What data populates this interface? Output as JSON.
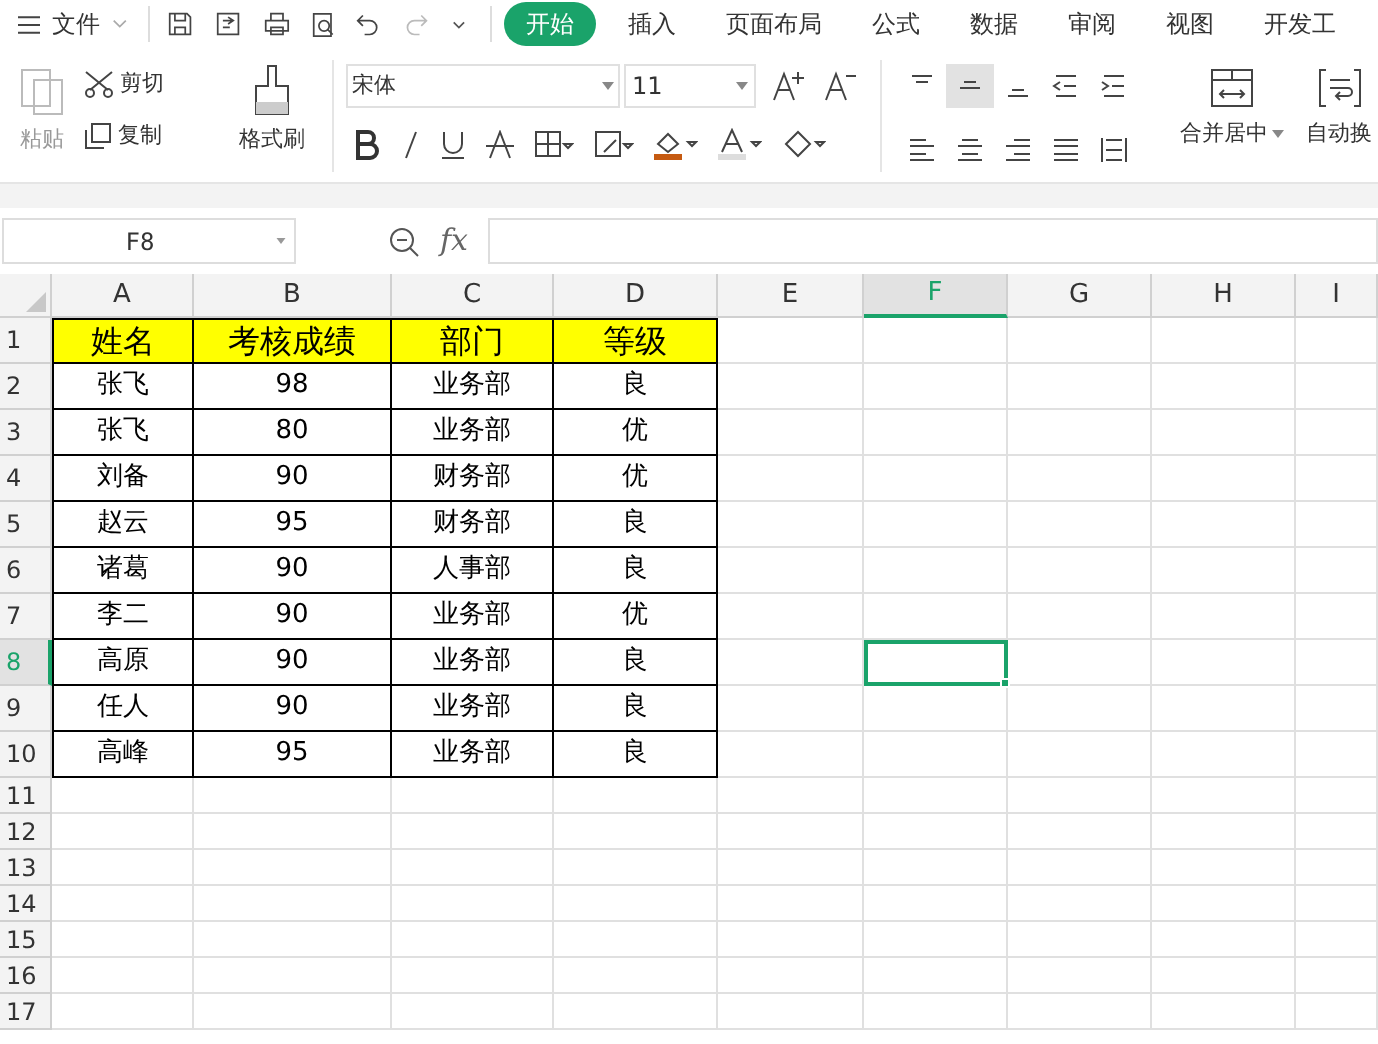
{
  "menu": {
    "file": "文件"
  },
  "tabs": [
    {
      "label": "开始",
      "selected": true
    },
    {
      "label": "插入",
      "selected": false
    },
    {
      "label": "页面布局",
      "selected": false
    },
    {
      "label": "公式",
      "selected": false
    },
    {
      "label": "数据",
      "selected": false
    },
    {
      "label": "审阅",
      "selected": false
    },
    {
      "label": "视图",
      "selected": false
    },
    {
      "label": "开发工",
      "selected": false
    }
  ],
  "ribbon": {
    "paste": "粘贴",
    "cut": "剪切",
    "copy": "复制",
    "format_painter": "格式刷",
    "font": "宋体",
    "font_size": "11",
    "merge_center": "合并居中",
    "wrap_text": "自动换"
  },
  "name_box": "F8",
  "formula_label": "fx",
  "columns": [
    {
      "label": "A",
      "selected": false
    },
    {
      "label": "B",
      "selected": false
    },
    {
      "label": "C",
      "selected": false
    },
    {
      "label": "D",
      "selected": false
    },
    {
      "label": "E",
      "selected": false
    },
    {
      "label": "F",
      "selected": true
    },
    {
      "label": "G",
      "selected": false
    },
    {
      "label": "H",
      "selected": false
    },
    {
      "label": "I",
      "selected": false
    }
  ],
  "rows": [
    {
      "label": "1",
      "kind": "header",
      "selected": false,
      "cells": [
        "姓名",
        "考核成绩",
        "部门",
        "等级"
      ]
    },
    {
      "label": "2",
      "kind": "data",
      "selected": false,
      "cells": [
        "张飞",
        "98",
        "业务部",
        "良"
      ]
    },
    {
      "label": "3",
      "kind": "data",
      "selected": false,
      "cells": [
        "张飞",
        "80",
        "业务部",
        "优"
      ]
    },
    {
      "label": "4",
      "kind": "data",
      "selected": false,
      "cells": [
        "刘备",
        "90",
        "财务部",
        "优"
      ]
    },
    {
      "label": "5",
      "kind": "data",
      "selected": false,
      "cells": [
        "赵云",
        "95",
        "财务部",
        "良"
      ]
    },
    {
      "label": "6",
      "kind": "data",
      "selected": false,
      "cells": [
        "诸葛",
        "90",
        "人事部",
        "良"
      ]
    },
    {
      "label": "7",
      "kind": "data",
      "selected": false,
      "cells": [
        "李二",
        "90",
        "业务部",
        "优"
      ]
    },
    {
      "label": "8",
      "kind": "data",
      "selected": true,
      "cells": [
        "高原",
        "90",
        "业务部",
        "良"
      ]
    },
    {
      "label": "9",
      "kind": "data",
      "selected": false,
      "cells": [
        "任人",
        "90",
        "业务部",
        "良"
      ]
    },
    {
      "label": "10",
      "kind": "data",
      "selected": false,
      "cells": [
        "高峰",
        "95",
        "业务部",
        "良"
      ]
    },
    {
      "label": "11",
      "kind": "empty",
      "selected": false
    },
    {
      "label": "12",
      "kind": "empty",
      "selected": false
    },
    {
      "label": "13",
      "kind": "empty",
      "selected": false
    },
    {
      "label": "14",
      "kind": "empty",
      "selected": false
    },
    {
      "label": "15",
      "kind": "empty",
      "selected": false
    },
    {
      "label": "16",
      "kind": "empty",
      "selected": false
    },
    {
      "label": "17",
      "kind": "empty",
      "selected": false
    }
  ]
}
